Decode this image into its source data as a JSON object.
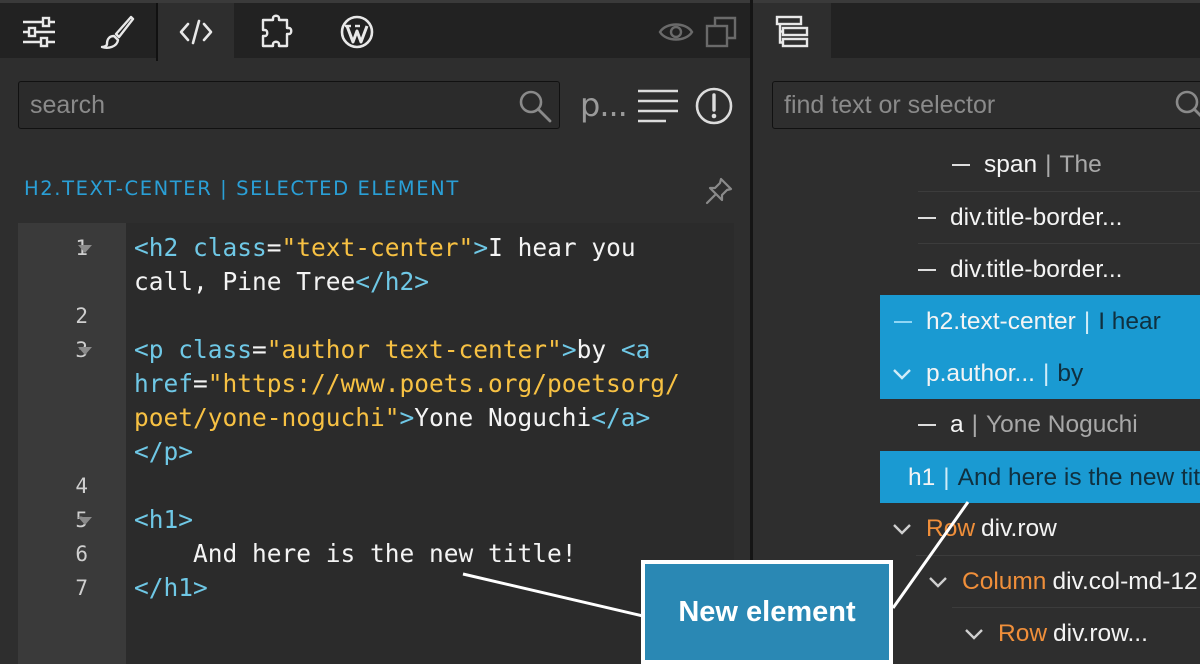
{
  "left_panel": {
    "toolbar": {
      "tabs": [
        {
          "icon": "sliders-icon"
        },
        {
          "icon": "brush-icon"
        },
        {
          "icon": "code-icon",
          "active": true
        },
        {
          "icon": "puzzle-icon"
        },
        {
          "icon": "wordpress-icon"
        }
      ],
      "right_icons": [
        "eye-icon",
        "copy-icon"
      ]
    },
    "search": {
      "placeholder": "search"
    },
    "para_label": "p...",
    "selected_label": "H2.TEXT-CENTER | SELECTED ELEMENT",
    "code_lines": [
      {
        "number": "1",
        "fold": true
      },
      {
        "number": "2",
        "fold": false
      },
      {
        "number": "3",
        "fold": true
      },
      {
        "number": "4",
        "fold": false
      },
      {
        "number": "5",
        "fold": true
      },
      {
        "number": "6",
        "fold": false
      },
      {
        "number": "7",
        "fold": false
      }
    ],
    "code": {
      "l1_open": "<h2 ",
      "l1_attr": "class",
      "l1_eq": "=",
      "l1_str": "\"text-center\"",
      "l1_close": ">",
      "l1_text": "I hear you",
      "l1b_text": "call, Pine Tree",
      "l1b_end": "</h2>",
      "l3_open": "<p ",
      "l3_attr": "class",
      "l3_eq": "=",
      "l3_str": "\"author text-center\"",
      "l3_close": ">",
      "l3_text": "by ",
      "l3_a": "<a",
      "l3b_attr": "href",
      "l3b_eq": "=",
      "l3b_str": "\"https://www.poets.org/poetsorg/",
      "l3c_str": "poet/yone-noguchi\"",
      "l3c_close": ">",
      "l3c_text": "Yone Noguchi",
      "l3c_end": "</a>",
      "l3d_end": "</p>",
      "l5_open": "<h1>",
      "l6_text": "    And here is the new title!",
      "l7_end": "</h1>"
    }
  },
  "right_panel": {
    "find": {
      "placeholder": "find text or selector"
    },
    "tree": [
      {
        "kind": "dash",
        "name": "span",
        "value": "The",
        "selected": false
      },
      {
        "kind": "dash",
        "name": "div.title-border...",
        "value": "",
        "selected": false
      },
      {
        "kind": "dash",
        "name": "div.title-border...",
        "value": "",
        "selected": false
      },
      {
        "kind": "dash",
        "name": "h2.text-center",
        "value": "I hear",
        "selected": true
      },
      {
        "kind": "chev",
        "name": "p.author...",
        "value": "by",
        "selected": true
      },
      {
        "kind": "dash",
        "name": "a",
        "value": "Yone Noguchi",
        "selected": false
      },
      {
        "kind": "dash",
        "name": "h1",
        "value": "And here is the new title!",
        "selected": true
      },
      {
        "kind": "chev",
        "keyword": "Row",
        "name": "div.row",
        "value": "",
        "selected": false
      },
      {
        "kind": "chev",
        "keyword": "Column",
        "name": "div.col-md-12",
        "value": "",
        "selected": false
      },
      {
        "kind": "chev",
        "keyword": "Row",
        "name": "div.row...",
        "value": "",
        "selected": false
      }
    ],
    "sep": "|"
  },
  "callout": {
    "text": "New element"
  },
  "colors": {
    "accent": "#1a9ad2",
    "tag": "#6fc8e6",
    "string": "#f7c143",
    "keyword": "#f08f3a",
    "callout_bg": "#2a88b4"
  }
}
